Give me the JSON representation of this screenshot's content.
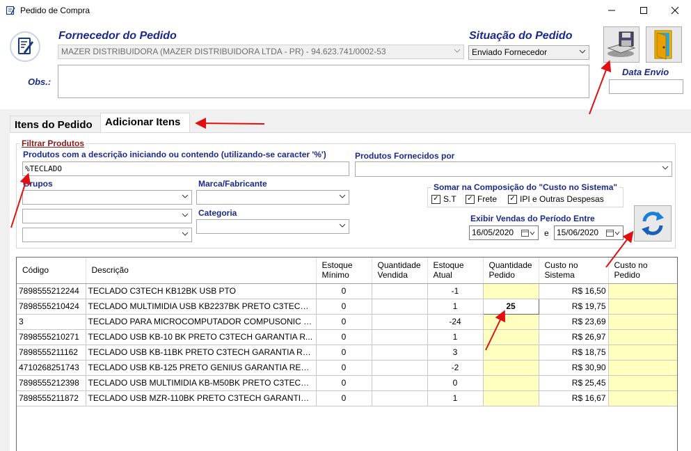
{
  "window": {
    "title": "Pedido de Compra"
  },
  "header": {
    "fornecedor_label": "Fornecedor do Pedido",
    "fornecedor_value": "MAZER DISTRIBUIDORA (MAZER DISTRIBUIDORA LTDA - PR) - 94.623.741/0002-53",
    "situacao_label": "Situação do Pedido",
    "situacao_value": "Enviado Fornecedor",
    "obs_label": "Obs.:",
    "obs_value": "",
    "data_envio_label": "Data Envio",
    "data_envio_value": ""
  },
  "tabs": [
    {
      "label": "Itens do Pedido",
      "active": false
    },
    {
      "label": "Adicionar Itens",
      "active": true
    }
  ],
  "filter": {
    "group_title": "Filtrar Produtos",
    "descricao_label": "Produtos com a descrição iniciando ou contendo (utilizando-se caracter '%')",
    "descricao_value": "%TECLADO",
    "fornecidos_label": "Produtos Fornecidos por",
    "fornecidos_value": "",
    "grupos_label": "Grupos",
    "marca_label": "Marca/Fabricante",
    "categoria_label": "Categoria",
    "somar_title": "Somar na Composição do \"Custo no Sistema\"",
    "checks": [
      {
        "label": "S.T",
        "checked": true
      },
      {
        "label": "Frete",
        "checked": true
      },
      {
        "label": "IPI e Outras Despesas",
        "checked": true
      }
    ],
    "periodo_label": "Exibir Vendas do Período Entre",
    "date_from": "16/05/2020",
    "date_sep": "e",
    "date_to": "15/06/2020"
  },
  "grid": {
    "columns": [
      "Código",
      "Descrição",
      "Estoque Mínimo",
      "Quantidade Vendida",
      "Estoque Atual",
      "Quantidade Pedido",
      "Custo no Sistema",
      "Custo no Pedido"
    ],
    "rows": [
      {
        "codigo": "7898555212244",
        "descricao": "TECLADO C3TECH KB12BK USB PTO",
        "min": "0",
        "vendida": "",
        "atual": "-1",
        "pedido": "",
        "custo": "R$ 16,50",
        "custo_pedido": ""
      },
      {
        "codigo": "7898555210424",
        "descricao": "TECLADO MULTIMIDIA USB KB2237BK PRETO C3TECH ...",
        "min": "0",
        "vendida": "",
        "atual": "1",
        "pedido": "25",
        "custo": "R$ 19,75",
        "custo_pedido": ""
      },
      {
        "codigo": "3",
        "descricao": "TECLADO PARA MICROCOMPUTADOR COMPUSONIC G...",
        "min": "0",
        "vendida": "",
        "atual": "-24",
        "pedido": "",
        "custo": "R$ 23,69",
        "custo_pedido": ""
      },
      {
        "codigo": "7898555210271",
        "descricao": "TECLADO USB KB-10 BK PRETO C3TECH GARANTIA R...",
        "min": "0",
        "vendida": "",
        "atual": "1",
        "pedido": "",
        "custo": "R$ 26,97",
        "custo_pedido": ""
      },
      {
        "codigo": "7898555211162",
        "descricao": "TECLADO USB KB-11BK PRETO C3TECH GARANTIA RE...",
        "min": "0",
        "vendida": "",
        "atual": "3",
        "pedido": "",
        "custo": "R$ 18,75",
        "custo_pedido": ""
      },
      {
        "codigo": "4710268251743",
        "descricao": "TECLADO USB KB-125 PRETO GENIUS GARANTIA RED...",
        "min": "0",
        "vendida": "",
        "atual": "-2",
        "pedido": "",
        "custo": "R$ 30,90",
        "custo_pedido": ""
      },
      {
        "codigo": "7898555212398",
        "descricao": "TECLADO USB MULTIMIDIA KB-M50BK PRETO C3TECH ...",
        "min": "0",
        "vendida": "",
        "atual": "0",
        "pedido": "",
        "custo": "R$ 25,45",
        "custo_pedido": ""
      },
      {
        "codigo": "7898555211872",
        "descricao": "TECLADO USB MZR-110BK PRETO C3TECH GARANTIA ...",
        "min": "0",
        "vendida": "",
        "atual": "1",
        "pedido": "",
        "custo": "R$ 16,67",
        "custo_pedido": ""
      }
    ]
  },
  "icons": {
    "app": "edit-document-icon",
    "save": "floppy-save-icon",
    "exit": "door-exit-icon",
    "refresh": "refresh-icon",
    "calendar": "calendar-icon"
  },
  "colors": {
    "label_blue": "#1a2a8c",
    "group_title_red": "#8b1a1a",
    "editable_yellow": "#ffffc0",
    "annotation_red": "#e01010"
  }
}
